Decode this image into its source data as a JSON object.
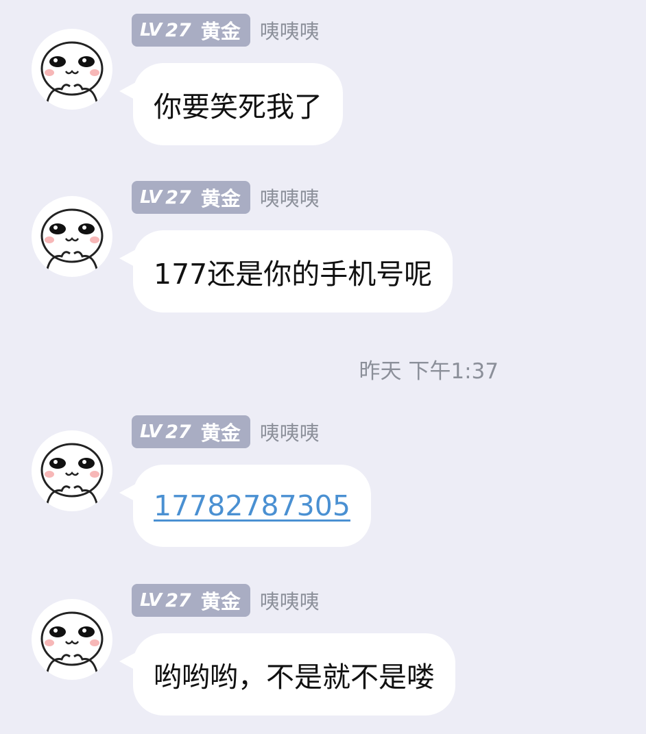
{
  "user": {
    "level_prefix": "LV",
    "level_number": "27",
    "tier": "黄金",
    "nickname": "咦咦咦",
    "avatar_icon": "sticker-face-icon"
  },
  "messages": [
    {
      "text": "你要笑死我了"
    },
    {
      "text": "177还是你的手机号呢"
    },
    {
      "text": "17782787305",
      "is_link": true,
      "link_color": "#4a90d2"
    },
    {
      "text": "哟哟哟，不是就不是喽"
    }
  ],
  "timestamp": "昨天 下午1:37",
  "colors": {
    "background": "#ededf6",
    "bubble": "#ffffff",
    "badge": "#a9adc3",
    "nickname": "#8b8f99"
  }
}
